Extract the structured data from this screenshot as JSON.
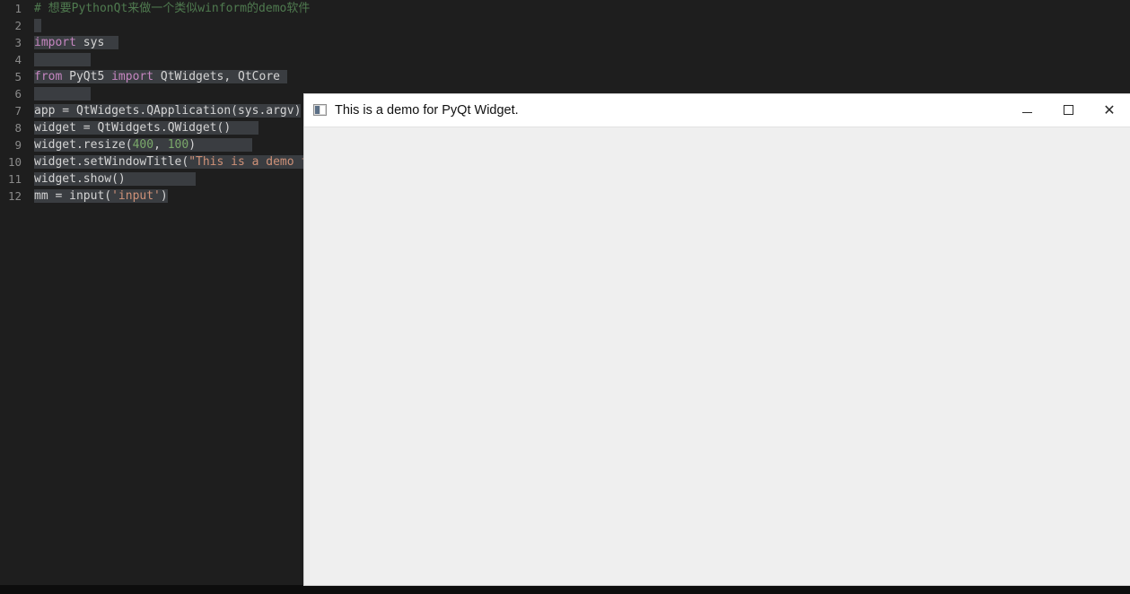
{
  "editor": {
    "name": "code-editor",
    "background_color": "#1e1e1e",
    "gutter_color": "#8a8a8a",
    "selection_color": "#3a3d41",
    "line_numbers": [
      "1",
      "2",
      "3",
      "4",
      "5",
      "6",
      "7",
      "8",
      "9",
      "10",
      "11",
      "12"
    ],
    "lines": [
      {
        "n": 1,
        "text": "# 想要PythonQt来做一个类似winform的demo软件"
      },
      {
        "n": 2,
        "text": ""
      },
      {
        "n": 3,
        "text": "import sys"
      },
      {
        "n": 4,
        "text": ""
      },
      {
        "n": 5,
        "text": "from PyQt5 import QtWidgets, QtCore"
      },
      {
        "n": 6,
        "text": ""
      },
      {
        "n": 7,
        "text": "app = QtWidgets.QApplication(sys.argv)"
      },
      {
        "n": 8,
        "text": "widget = QtWidgets.QWidget()"
      },
      {
        "n": 9,
        "text": "widget.resize(400, 100)"
      },
      {
        "n": 10,
        "text": "widget.setWindowTitle(\"This is a demo for PyQt Widget.\")"
      },
      {
        "n": 11,
        "text": "widget.show()"
      },
      {
        "n": 12,
        "text": "mm = input('input')"
      }
    ],
    "tokens": {
      "comment_1": "# 想要PythonQt来做一个类似winform的demo软件",
      "kw_import": "import",
      "kw_from": "from",
      "id_sys": "sys",
      "id_pyqt5": "PyQt5",
      "id_qtwidgets": "QtWidgets",
      "id_qtcore": "QtCore",
      "num_400": "400",
      "num_100": "100",
      "str_title": "\"This is a demo for PyQt Widget.\"",
      "str_input": "'input'"
    }
  },
  "qt_window": {
    "title": "This is a demo for PyQt Widget.",
    "icon": "window-pane-icon",
    "titlebar_color": "#ffffff",
    "client_color": "#efefef",
    "controls": {
      "minimize": "–",
      "maximize": "□",
      "close": "✕"
    }
  }
}
